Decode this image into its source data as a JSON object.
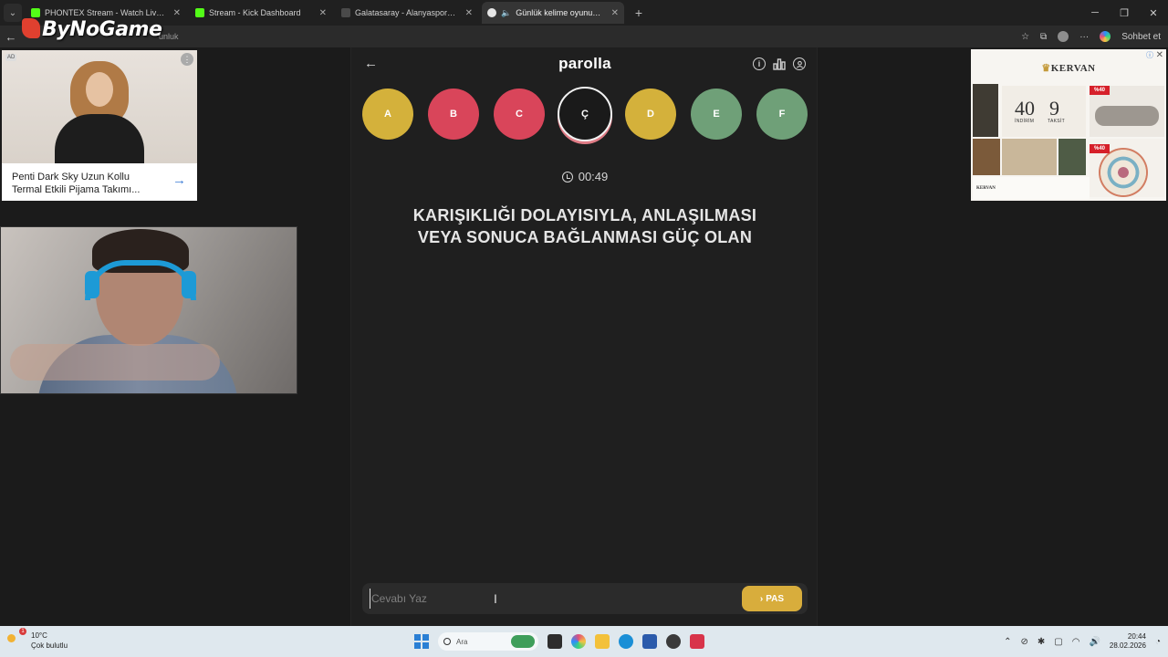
{
  "browser": {
    "tabs": [
      {
        "title": "PHONTEX Stream - Watch Live on",
        "favicon_color": "#53fc18",
        "active": false
      },
      {
        "title": "Stream - Kick Dashboard",
        "favicon_color": "#53fc18",
        "active": false
      },
      {
        "title": "Galatasaray - Alanyaspor Canlı Sk",
        "favicon_color": "#4a4a4a",
        "active": false
      },
      {
        "title": "Günlük kelime oyunu - paroll",
        "favicon_color": "#e6e6e6",
        "active": true
      }
    ],
    "address_fragment": "unluk",
    "profile_label": "Sohbet et",
    "overlay_logo": "ByNoGame"
  },
  "ads": {
    "left": {
      "badge": "AD",
      "title": "Penti Dark Sky Uzun Kollu Termal Etkili Pijama Takımı..."
    },
    "right": {
      "brand": "KERVAN",
      "discount_number": "40",
      "installment_number": "9",
      "discount_label": "İNDİRİM",
      "installment_label": "TAKSİT",
      "tag1": "%40",
      "tag2": "%40",
      "footer_brand": "KERVAN"
    }
  },
  "game": {
    "brand": "parolla",
    "icons": [
      "info-icon",
      "stats-icon",
      "profile-icon"
    ],
    "letters": [
      {
        "label": "A",
        "state": "correct",
        "color": "#d4b13b"
      },
      {
        "label": "B",
        "state": "wrong",
        "color": "#d9455a"
      },
      {
        "label": "C",
        "state": "wrong",
        "color": "#d9455a"
      },
      {
        "label": "Ç",
        "state": "current",
        "color": "#1a1a1a"
      },
      {
        "label": "D",
        "state": "correct",
        "color": "#d4b13b"
      },
      {
        "label": "E",
        "state": "passed",
        "color": "#6fa078"
      },
      {
        "label": "F",
        "state": "passed",
        "color": "#6fa078"
      }
    ],
    "timer": "00:49",
    "question": "KARIŞIKLIĞI DOLAYISIYLA, ANLAŞILMASI VEYA SONUCA BAĞLANMASI GÜÇ OLAN",
    "answer_placeholder": "Cevabı Yaz",
    "answer_value": "",
    "pass_label": "PAS"
  },
  "taskbar": {
    "temperature": "10°C",
    "weather": "Çok bulutlu",
    "search_placeholder": "Ara",
    "time": "20:44",
    "date": "28.02.2026",
    "alert_count": "1"
  }
}
